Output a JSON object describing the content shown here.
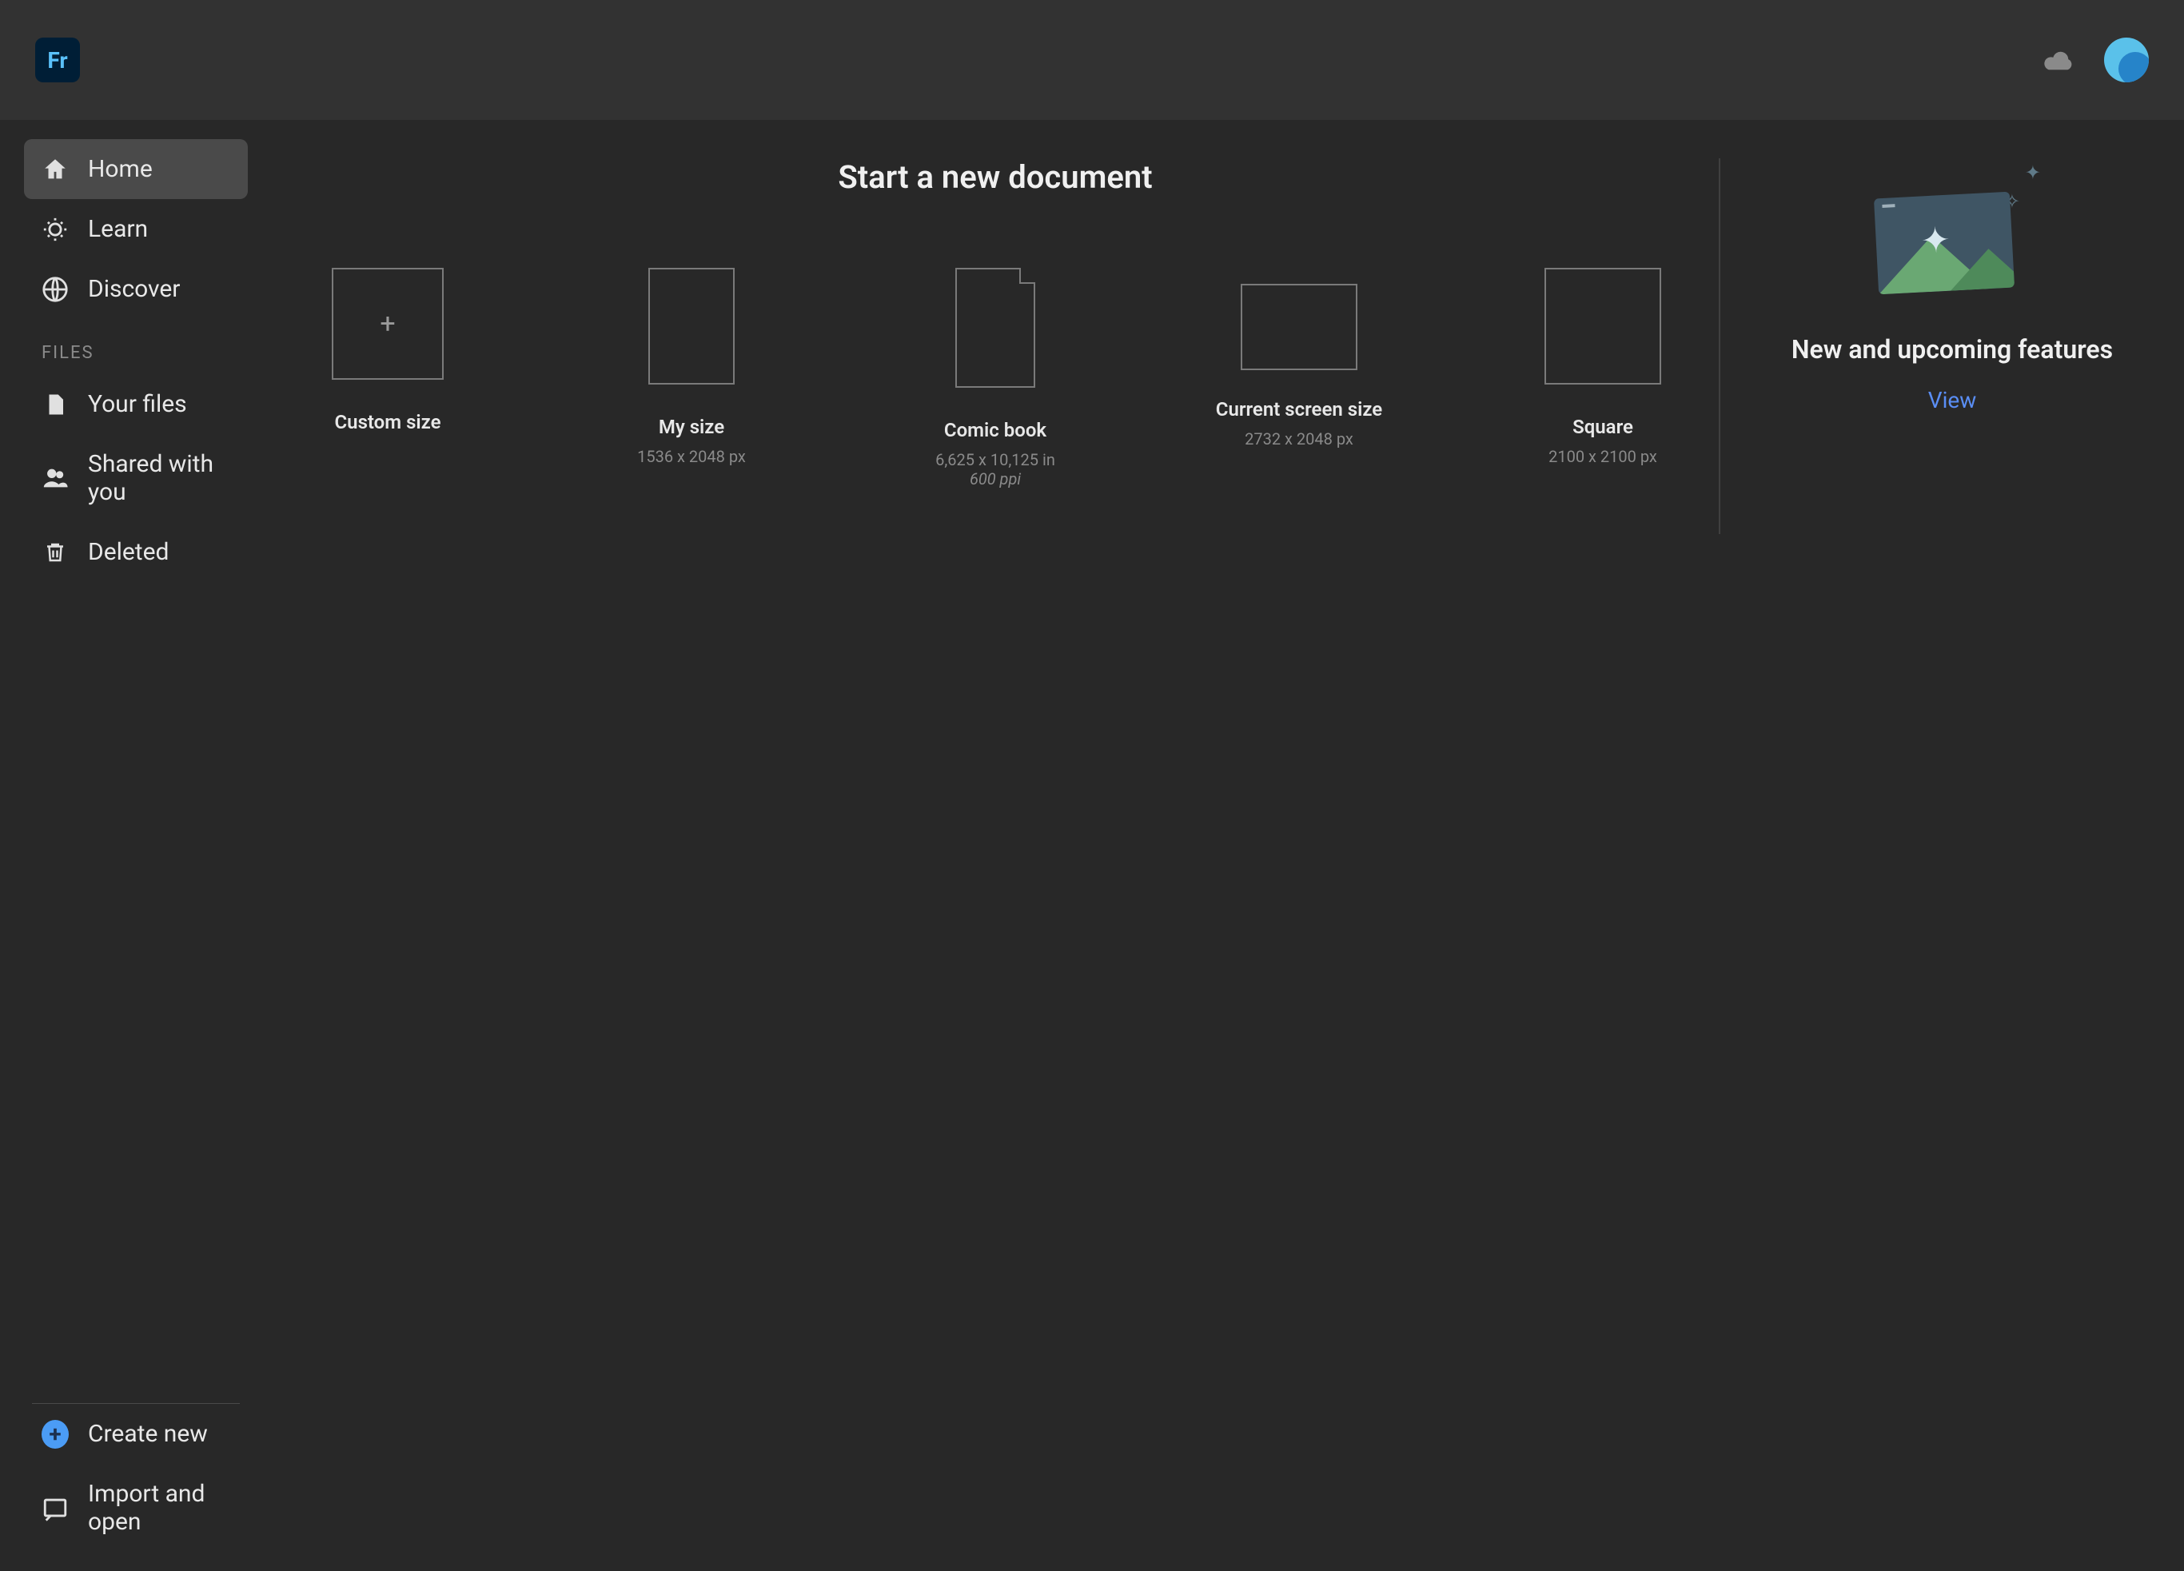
{
  "app": {
    "logo_text": "Fr"
  },
  "sidebar": {
    "nav": [
      {
        "label": "Home"
      },
      {
        "label": "Learn"
      },
      {
        "label": "Discover"
      }
    ],
    "section_label": "FILES",
    "files": [
      {
        "label": "Your files"
      },
      {
        "label": "Shared with you"
      },
      {
        "label": "Deleted"
      }
    ],
    "actions": {
      "create_label": "Create new",
      "import_label": "Import and open"
    }
  },
  "content": {
    "title": "Start a new document",
    "presets": [
      {
        "name": "Custom size",
        "dim": "",
        "ppi": ""
      },
      {
        "name": "My size",
        "dim": "1536 x 2048 px",
        "ppi": ""
      },
      {
        "name": "Comic book",
        "dim": "6,625 x 10,125 in",
        "ppi": "600 ppi"
      },
      {
        "name": "Current screen size",
        "dim": "2732 x 2048 px",
        "ppi": ""
      },
      {
        "name": "Square",
        "dim": "2100 x 2100 px",
        "ppi": ""
      }
    ]
  },
  "whatsnew": {
    "title": "New and upcoming features",
    "link": "View"
  }
}
